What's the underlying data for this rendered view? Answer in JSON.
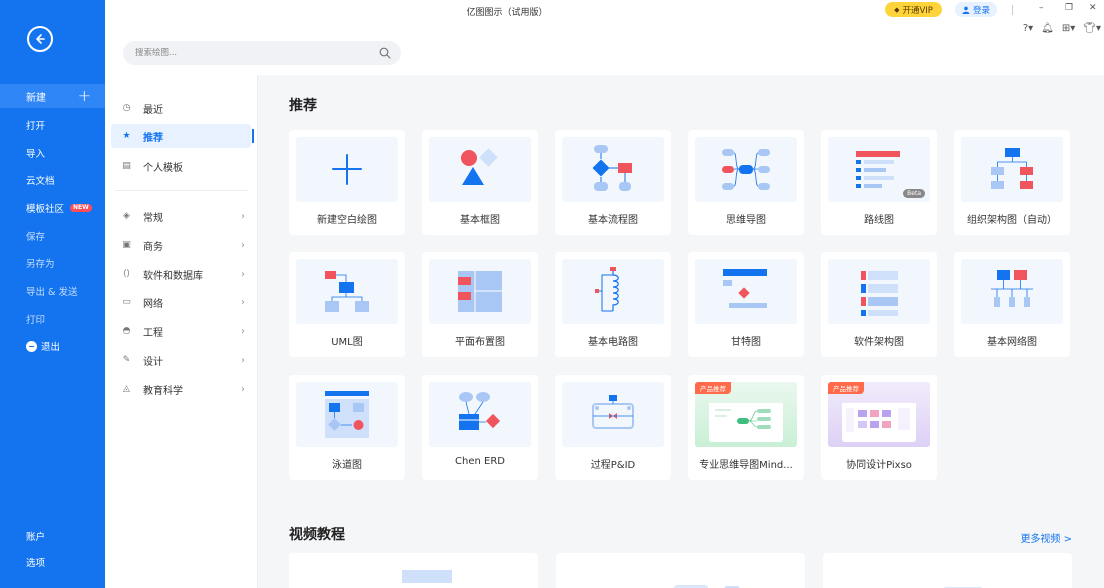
{
  "window": {
    "title": "亿图图示（试用版）"
  },
  "header": {
    "vip_label": "开通VIP",
    "login_label": "登录",
    "search_placeholder": "搜索绘图..."
  },
  "sidebar": {
    "new_label": "新建",
    "items": [
      "打开",
      "导入",
      "云文档",
      "模板社区",
      "保存",
      "另存为",
      "导出 & 发送",
      "打印",
      "退出"
    ],
    "new_badge": "NEW",
    "bottom": [
      "账户",
      "选项"
    ]
  },
  "categories": {
    "top": [
      "最近",
      "推荐",
      "个人模板"
    ],
    "groups": [
      "常规",
      "商务",
      "软件和数据库",
      "网络",
      "工程",
      "设计",
      "教育科学"
    ]
  },
  "main": {
    "recommend_title": "推荐",
    "cards": [
      "新建空白绘图",
      "基本框图",
      "基本流程图",
      "思维导图",
      "路线图",
      "组织架构图（自动）",
      "UML图",
      "平面布置图",
      "基本电路图",
      "甘特图",
      "软件架构图",
      "基本网络图",
      "泳道图",
      "Chen ERD",
      "过程P&ID",
      "专业思维导图Mind...",
      "协同设计Pixso"
    ],
    "beta_label": "Beta",
    "promo_label": "产品推荐",
    "video_title": "视频教程",
    "more_videos": "更多视频 >"
  },
  "colors": {
    "brand": "#1474f0",
    "accent_red": "#f0545c",
    "vip_yellow": "#ffd43b"
  }
}
